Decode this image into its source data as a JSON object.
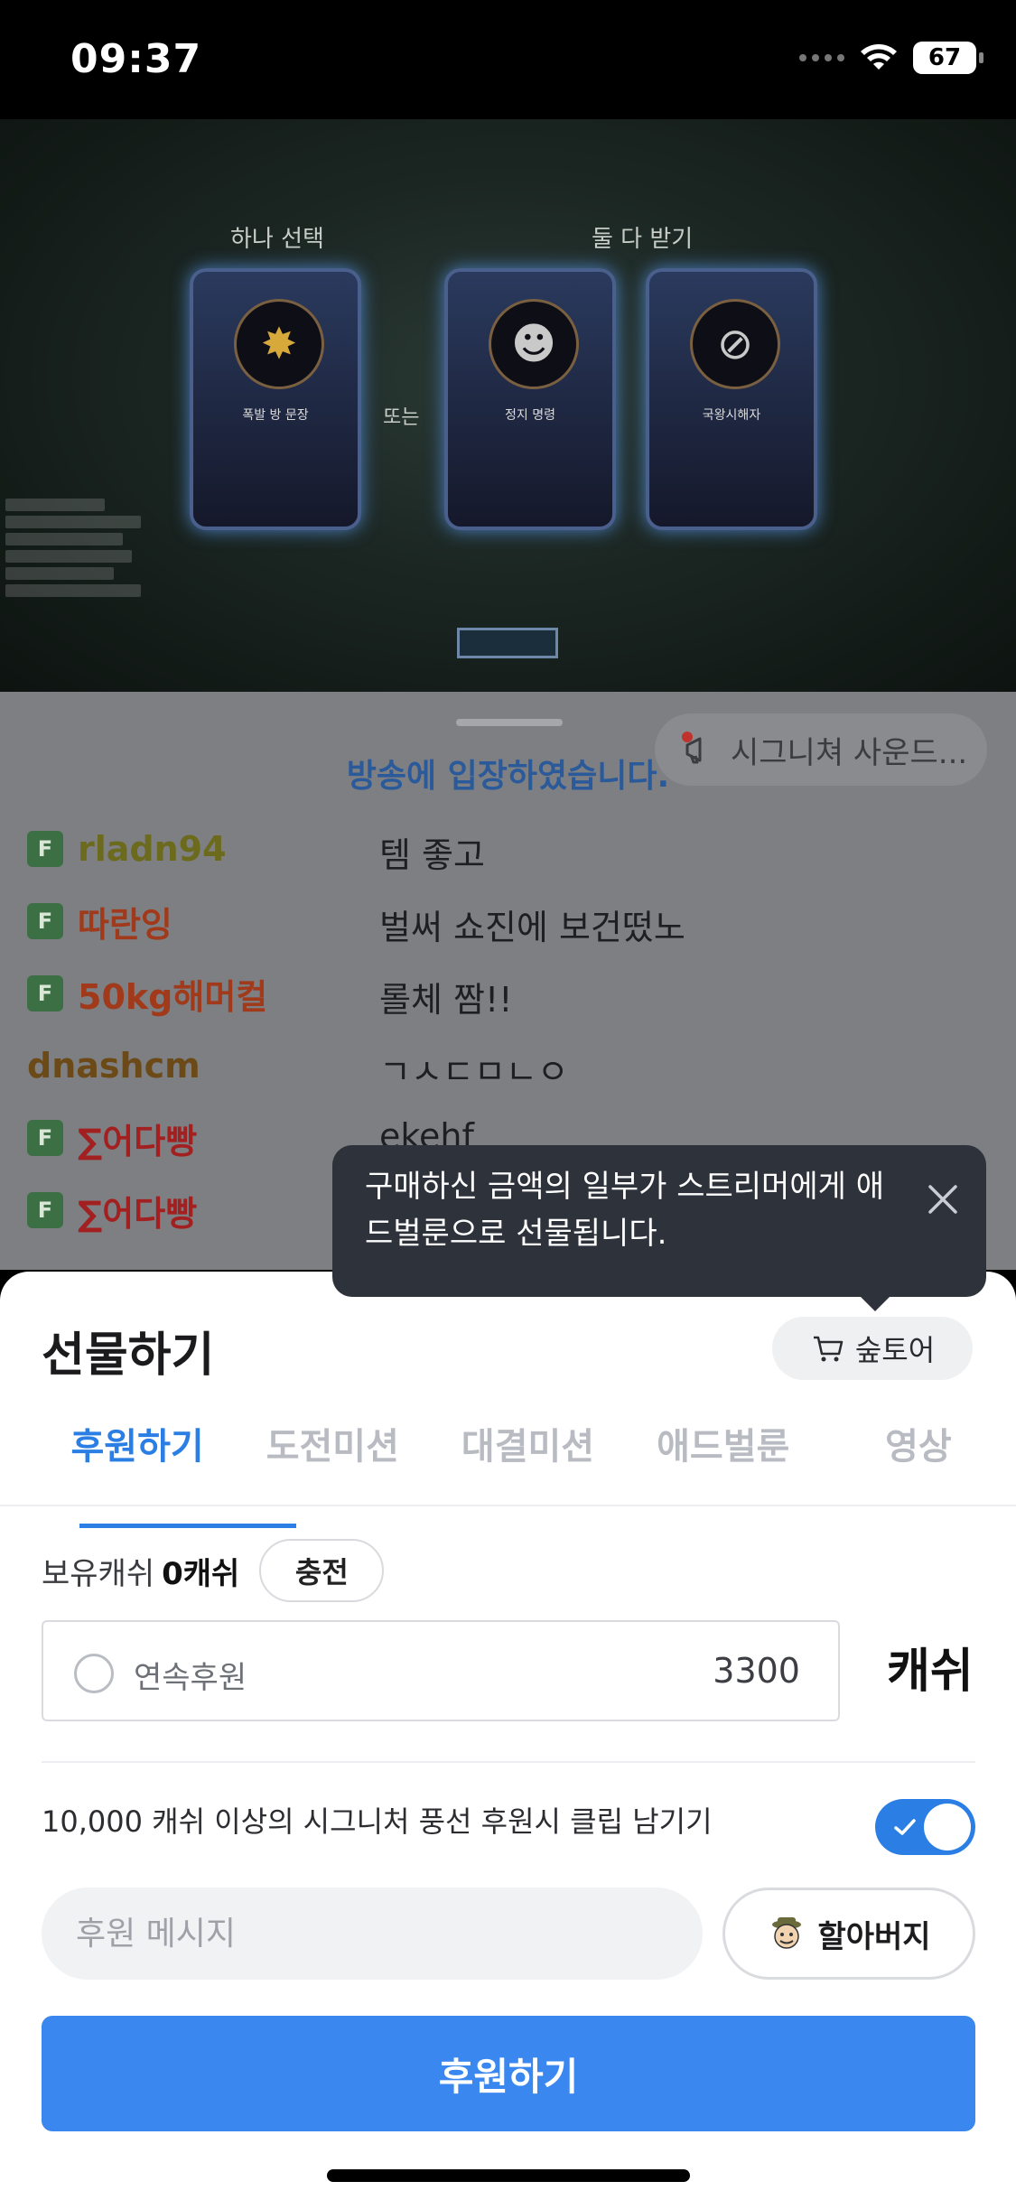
{
  "status_bar": {
    "time": "09:37",
    "battery": "67"
  },
  "video": {
    "top_label_left": "하나 선택",
    "top_label_right": "둘 다 받기",
    "middle_word": "또는",
    "card1_title": "폭발 방 문장",
    "card2_title": "정지 명령",
    "card3_title": "국왕시해자"
  },
  "chat": {
    "signature_label": "시그니쳐 사운드...",
    "entered_text": "방송에 입장하였습니다.",
    "fan_badge": "F",
    "rows": [
      {
        "user": "rladn94",
        "message": "템 좋고",
        "color": "#6b6a1d",
        "badge": true
      },
      {
        "user": "따란잉",
        "message": "벌써 쇼진에 보건떴노",
        "color": "#a13a1a",
        "badge": true
      },
      {
        "user": "50kg해머컬",
        "message": "롤체 짬!!",
        "color": "#a13a1a",
        "badge": true
      },
      {
        "user": "dnashcm",
        "message": "ㄱㅅㄷㅁㄴㅇ",
        "color": "#6b4a18",
        "badge": false
      },
      {
        "user": "∑어다빵",
        "message": "ekehf",
        "color": "#a32020",
        "badge": true
      },
      {
        "user": "∑어다빵",
        "message": "",
        "color": "#a32020",
        "badge": true
      }
    ]
  },
  "tooltip": {
    "text": "구매하신 금액의 일부가 스트리머에게 애드벌룬으로 선물됩니다."
  },
  "sheet": {
    "title": "선물하기",
    "shop_label": "숲토어",
    "tabs": [
      "후원하기",
      "도전미션",
      "대결미션",
      "애드벌룬",
      "영상"
    ],
    "cash_label": "보유캐쉬",
    "cash_amount": "0캐쉬",
    "charge_label": "충전",
    "continuous_label": "연속후원",
    "amount_value": "3300",
    "cash_unit": "캐쉬",
    "clip_text": "10,000 캐쉬 이상의 시그니처 풍선 후원시 클립 남기기",
    "clip_enabled": true,
    "message_placeholder": "후원 메시지",
    "voice_label": "할아버지",
    "donate_label": "후원하기"
  }
}
